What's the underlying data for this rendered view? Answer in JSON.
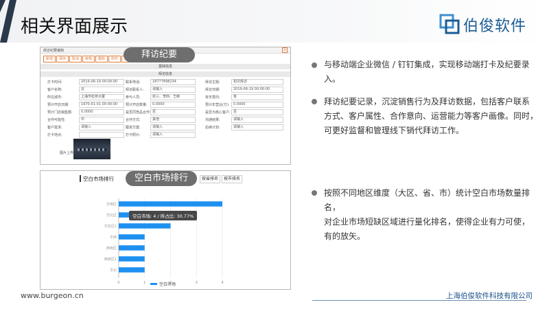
{
  "header": {
    "title": "相关界面展示",
    "brand": "伯俊软件"
  },
  "visit_panel": {
    "badge": "拜访纪要",
    "window_title": "拜访纪要编辑",
    "toolbar": [
      "新增",
      "保存",
      "取消",
      "审核",
      "删除",
      "附件",
      "返回"
    ],
    "section_basic": "基础信息",
    "section_visit": "拜访信息",
    "rows": [
      [
        {
          "label": "打卡时间:",
          "value": "2019-06-19 00:00:00"
        },
        {
          "label": "联系电话:",
          "value": "18777898234"
        },
        {
          "label": "拜访主题:",
          "value": "初次拜访"
        }
      ],
      [
        {
          "label": "客户名称:",
          "value": "云"
        },
        {
          "label": "拜访联系人:",
          "value": "请输入"
        },
        {
          "label": "拜访日期:",
          "value": "2019-06-19 00:00:00"
        }
      ],
      [
        {
          "label": "所在城市:",
          "value": "上海市虹桥大厦"
        },
        {
          "label": "参与人员:",
          "value": "张三、李四、王麻"
        },
        {
          "label": "有无意向:",
          "value": "有"
        }
      ],
      [
        {
          "label": "预计开店日期:",
          "value": "1970-01-01 00:00:00"
        },
        {
          "label": "预计开店数量:",
          "value": "0.0000"
        },
        {
          "label": "预计年营业(万):",
          "value": "0.0000"
        }
      ],
      [
        {
          "label": "预计门店销售额:",
          "value": "0.0000"
        },
        {
          "label": "是否同竞品合作:",
          "value": "否"
        },
        {
          "label": "是否为核心客户:",
          "value": "否"
        }
      ],
      [
        {
          "label": "合作可能性:",
          "value": "中"
        },
        {
          "label": "合作方式:",
          "value": "其他"
        },
        {
          "label": "沟通结果:",
          "value": "请输入"
        }
      ],
      [
        {
          "label": "客户需求:",
          "value": "请输入"
        },
        {
          "label": "跟进方案:",
          "value": "请输入"
        },
        {
          "label": "后续计划:",
          "value": "请输入"
        }
      ],
      [
        {
          "label": "打卡地点:",
          "value": ""
        },
        {
          "label": "打卡照片:",
          "value": "请输入"
        },
        {
          "label": "",
          "value": ""
        }
      ]
    ],
    "image_label": "图片上传:"
  },
  "rank_panel": {
    "badge": "空白市场排行",
    "title": "空白市场排行",
    "tabs": [
      "按省排名",
      "按市排名"
    ],
    "tooltip": "空白市场: 4 / 所占比: 30.77%",
    "legend": "空白市场"
  },
  "chart_data": {
    "type": "bar",
    "orientation": "horizontal",
    "title": "",
    "categories": [
      "华南区",
      "华北区",
      "华东区1",
      "华南",
      "西南区",
      "西南区1",
      "华北"
    ],
    "series": [
      {
        "name": "空白市场",
        "values": [
          4,
          3,
          2,
          1,
          1,
          1,
          1
        ]
      }
    ],
    "xlim": [
      0,
      4
    ],
    "x_ticks": [
      "0",
      "1",
      "2",
      "3",
      "4"
    ],
    "legend_position": "bottom",
    "grid": true,
    "color": "#1e90f0"
  },
  "bullets": [
    {
      "text": [
        "与移动端企业微信 / 钉钉集成，实现移动端打卡及纪要录入。"
      ]
    },
    {
      "text": [
        "拜访纪要记录，沉淀销售行为及拜访数据，包括客户联系",
        "方式、客户属性、合作意向、运营能力等客户画像。同时，",
        "可更好监督和管理线下销代拜访工作。"
      ]
    },
    {
      "text": [
        "按照不同地区维度（大区、省、市）统计空白市场数量排名，",
        "对企业市场短缺区域进行量化排名，使得企业有力可使，",
        "有的放矢。"
      ]
    }
  ],
  "footer": {
    "url": "www.burgeon.cn",
    "company": "上海伯俊软件科技有限公司"
  }
}
